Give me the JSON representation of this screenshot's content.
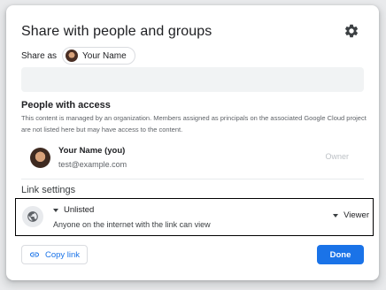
{
  "dialog": {
    "title": "Share with people and groups",
    "settings_icon": "gear-icon"
  },
  "share_as": {
    "label": "Share as",
    "identity_name": "Your Name"
  },
  "add_people": {
    "value": "",
    "placeholder": ""
  },
  "people_with_access": {
    "heading": "People with access",
    "note": "This content is managed by an organization. Members assigned as principals on the associated Google Cloud project are not listed here but may have access to the content.",
    "members": [
      {
        "name": "Your Name (you)",
        "email": "test@example.com",
        "role": "Owner"
      }
    ]
  },
  "link_settings": {
    "heading": "Link settings",
    "icon": "globe-icon",
    "access": "Unlisted",
    "description": "Anyone on the internet with the link can view",
    "role": "Viewer"
  },
  "footer": {
    "copy_link_label": "Copy link",
    "done_label": "Done"
  },
  "colors": {
    "accent": "#1a73e8",
    "text_primary": "#202124",
    "text_secondary": "#5f6368",
    "muted": "#bdc1c6"
  }
}
